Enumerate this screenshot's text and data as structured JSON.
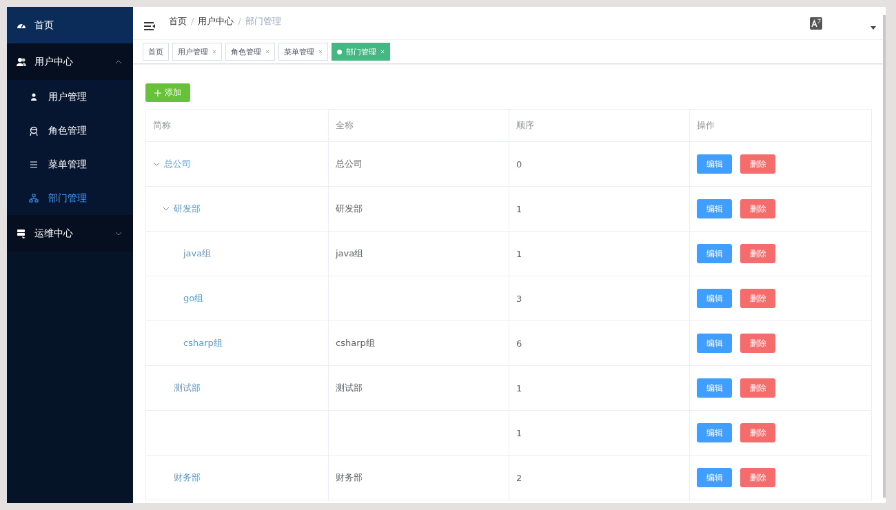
{
  "sidebar": {
    "items": [
      {
        "kind": "link",
        "label": "首页",
        "selected": false
      },
      {
        "kind": "group",
        "label": "用户中心",
        "expanded": true,
        "children": [
          {
            "label": "用户管理",
            "selected": false
          },
          {
            "label": "角色管理",
            "selected": false
          },
          {
            "label": "菜单管理",
            "selected": false
          },
          {
            "label": "部门管理",
            "selected": true
          }
        ]
      },
      {
        "kind": "group",
        "label": "运维中心",
        "expanded": false
      }
    ]
  },
  "header": {
    "breadcrumb": [
      "首页",
      "/",
      "用户中心",
      "/",
      "部门管理"
    ]
  },
  "tabs": [
    {
      "label": "首页",
      "closable": false,
      "selected": false
    },
    {
      "label": "用户管理",
      "closable": true,
      "selected": false
    },
    {
      "label": "角色管理",
      "closable": true,
      "selected": false
    },
    {
      "label": "菜单管理",
      "closable": true,
      "selected": false
    },
    {
      "label": "部门管理",
      "closable": true,
      "selected": true
    }
  ],
  "add_button": {
    "label": "添加"
  },
  "table": {
    "columns": [
      "简称",
      "全称",
      "顺序",
      "操作"
    ],
    "rows": [
      {
        "name": "总公司",
        "full_name": "总公司",
        "order": "0",
        "expanded": true,
        "actions": [
          {
            "kind": "edit",
            "label": "编辑"
          },
          {
            "kind": "delete",
            "label": "删除"
          }
        ],
        "children": [
          {
            "name": "研发部",
            "full_name": "研发部",
            "order": "1",
            "expanded": true,
            "actions": [
              {
                "kind": "edit",
                "label": "编辑"
              },
              {
                "kind": "delete",
                "label": "删除"
              }
            ],
            "children": [
              {
                "name": "java组",
                "full_name": "java组",
                "order": "1",
                "actions": [
                  {
                    "kind": "edit",
                    "label": "编辑"
                  },
                  {
                    "kind": "delete",
                    "label": "删除"
                  }
                ]
              },
              {
                "name": "go组",
                "order": "3",
                "actions": [
                  {
                    "kind": "edit",
                    "label": "编辑"
                  },
                  {
                    "kind": "delete",
                    "label": "删除"
                  }
                ]
              },
              {
                "name": "csharp组",
                "full_name": "csharp组",
                "order": "6",
                "actions": [
                  {
                    "kind": "edit",
                    "label": "编辑"
                  },
                  {
                    "kind": "delete",
                    "label": "删除"
                  }
                ]
              }
            ]
          },
          {
            "name": "测试部",
            "full_name": "测试部",
            "order": "1",
            "actions": [
              {
                "kind": "edit",
                "label": "编辑"
              },
              {
                "kind": "delete",
                "label": "删除"
              }
            ]
          },
          {
            "order": "1",
            "actions": [
              {
                "kind": "edit",
                "label": "编辑"
              },
              {
                "kind": "delete",
                "label": "删除"
              }
            ]
          },
          {
            "name": "财务部",
            "full_name": "财务部",
            "order": "2",
            "actions": [
              {
                "kind": "edit",
                "label": "编辑"
              },
              {
                "kind": "delete",
                "label": "删除"
              }
            ]
          }
        ]
      }
    ]
  }
}
